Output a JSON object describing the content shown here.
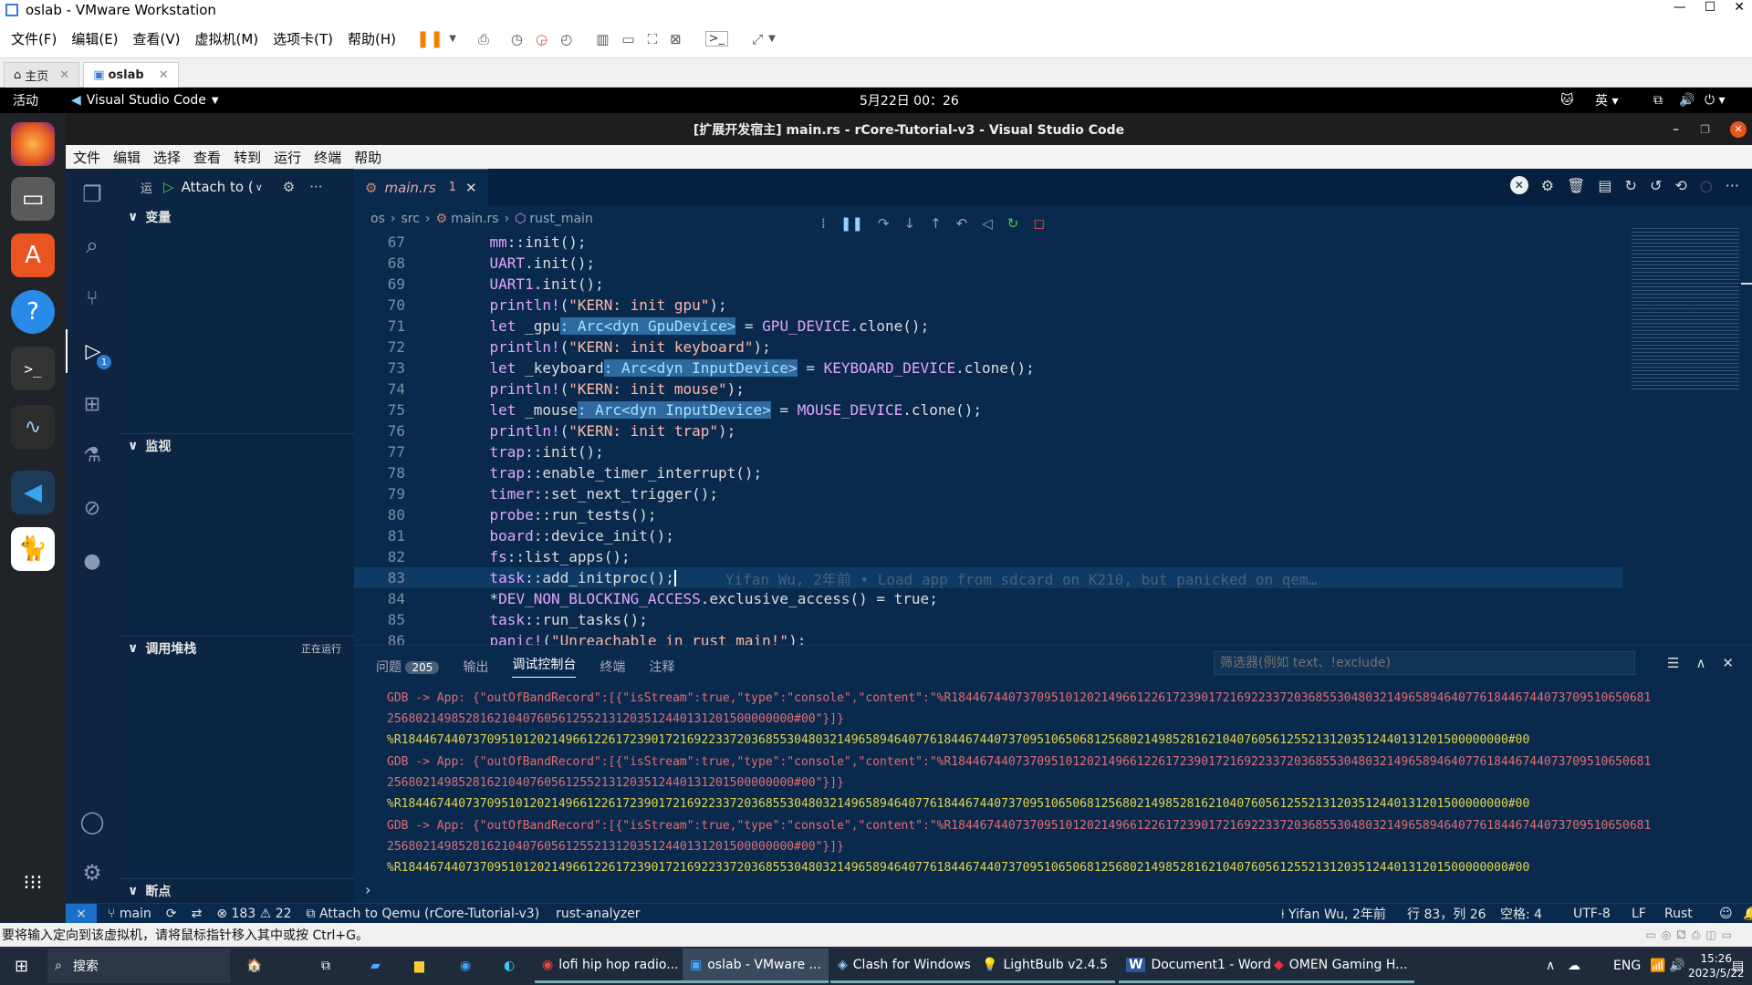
{
  "vmware": {
    "title": "oslab - VMware Workstation",
    "menu": [
      "文件(F)",
      "编辑(E)",
      "查看(V)",
      "虚拟机(M)",
      "选项卡(T)",
      "帮助(H)"
    ],
    "tabs": [
      "主页",
      "oslab"
    ],
    "status_text": "要将输入定向到该虚拟机，请将鼠标指针移入其中或按 Ctrl+G。"
  },
  "gnome": {
    "activities": "活动",
    "app_name": "Visual Studio Code",
    "clock": "5月22日  00：26",
    "lang": "英"
  },
  "vscode": {
    "title": "[扩展开发宿主] main.rs - rCore-Tutorial-v3 - Visual Studio Code",
    "menu": [
      "文件",
      "编辑",
      "选择",
      "查看",
      "转到",
      "运行",
      "终端",
      "帮助"
    ],
    "debug_badge": "1",
    "sidebar": {
      "run_label": "运",
      "config": "Attach to (",
      "variables": "变量",
      "watch": "监视",
      "callstack": "调用堆栈",
      "callstack_status": "正在运行",
      "breakpoints": "断点"
    },
    "tab": {
      "name": "main.rs",
      "problems": "1"
    },
    "breadcrumb": [
      "os",
      "src",
      "main.rs",
      "rust_main"
    ],
    "blame": "Yifan Wu, 2年前 • Load app from sdcard on K210, but panicked on qem…",
    "code": [
      {
        "n": "67",
        "t": "    mm::init();"
      },
      {
        "n": "68",
        "t": "    UART.init();"
      },
      {
        "n": "69",
        "t": "    UART1.init();"
      },
      {
        "n": "70",
        "t": "    println!(\"KERN: init gpu\");"
      },
      {
        "n": "71",
        "t": "    let _gpu: Arc<dyn GpuDevice> = GPU_DEVICE.clone();"
      },
      {
        "n": "72",
        "t": "    println!(\"KERN: init keyboard\");"
      },
      {
        "n": "73",
        "t": "    let _keyboard: Arc<dyn InputDevice> = KEYBOARD_DEVICE.clone();"
      },
      {
        "n": "74",
        "t": "    println!(\"KERN: init mouse\");"
      },
      {
        "n": "75",
        "t": "    let _mouse: Arc<dyn InputDevice> = MOUSE_DEVICE.clone();"
      },
      {
        "n": "76",
        "t": "    println!(\"KERN: init trap\");"
      },
      {
        "n": "77",
        "t": "    trap::init();"
      },
      {
        "n": "78",
        "t": "    trap::enable_timer_interrupt();"
      },
      {
        "n": "79",
        "t": "    timer::set_next_trigger();"
      },
      {
        "n": "80",
        "t": "    probe::run_tests();"
      },
      {
        "n": "81",
        "t": "    board::device_init();"
      },
      {
        "n": "82",
        "t": "    fs::list_apps();"
      },
      {
        "n": "83",
        "t": "    task::add_initproc();"
      },
      {
        "n": "84",
        "t": "    *DEV_NON_BLOCKING_ACCESS.exclusive_access() = true;"
      },
      {
        "n": "85",
        "t": "    task::run_tasks();"
      },
      {
        "n": "86",
        "t": "    panic!(\"Unreachable in rust_main!\");"
      }
    ],
    "panel": {
      "tabs": [
        "问题",
        "输出",
        "调试控制台",
        "终端",
        "注释"
      ],
      "problems_count": "205",
      "filter_placeholder": "筛选器(例如 text、!exclude)",
      "lines": [
        "GDB -> App: {\"outOfBandRecord\":[{\"isStream\":true,\"type\":\"console\",\"content\":\"%R18446744073709510120214966122617239017216922337203685530480321496589464077618446744073709510650681",
        "256802149852816210407605612552131203512440131201500000000#00\"}]}",
        "%R18446744073709510120214966122617239017216922337203685530480321496589464077618446744073709510650681256802149852816210407605612552131203512440131201500000000#00",
        "GDB -> App: {\"outOfBandRecord\":[{\"isStream\":true,\"type\":\"console\",\"content\":\"%R18446744073709510120214966122617239017216922337203685530480321496589464077618446744073709510650681",
        "256802149852816210407605612552131203512440131201500000000#00\"}]}",
        "%R18446744073709510120214966122617239017216922337203685530480321496589464077618446744073709510650681256802149852816210407605612552131203512440131201500000000#00",
        "GDB -> App: {\"outOfBandRecord\":[{\"isStream\":true,\"type\":\"console\",\"content\":\"%R18446744073709510120214966122617239017216922337203685530480321496589464077618446744073709510650681",
        "256802149852816210407605612552131203512440131201500000000#00\"}]}",
        "%R18446744073709510120214966122617239017216922337203685530480321496589464077618446744073709510650681256802149852816210407605612552131203512440131201500000000#00"
      ]
    },
    "status": {
      "branch": "main",
      "errors": "183",
      "warnings": "22",
      "debug": "Attach to Qemu (rCore-Tutorial-v3)",
      "analyzer": "rust-analyzer",
      "blame": "Yifan Wu, 2年前",
      "position": "行 83，列 26",
      "spaces": "空格: 4",
      "encoding": "UTF-8",
      "eol": "LF",
      "lang": "Rust"
    }
  },
  "taskbar": {
    "search": "搜索",
    "apps": [
      "lofi hip hop radio...",
      "oslab - VMware ...",
      "Clash for Windows",
      "LightBulb v2.4.5",
      "Document1 - Word",
      "OMEN Gaming H..."
    ],
    "ime": "ENG",
    "time": "15:26",
    "date": "2023/5/22"
  }
}
